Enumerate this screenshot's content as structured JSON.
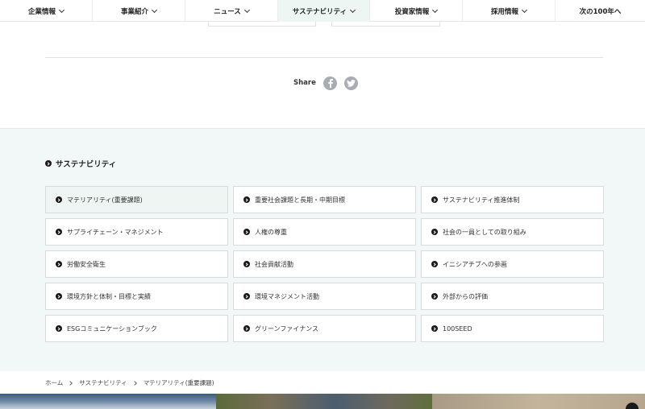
{
  "nav": {
    "items": [
      {
        "label": "企業情報",
        "dropdown": true
      },
      {
        "label": "事業紹介",
        "dropdown": true
      },
      {
        "label": "ニュース",
        "dropdown": true
      },
      {
        "label": "サステナビリティ",
        "dropdown": true,
        "active": true
      },
      {
        "label": "投資家情報",
        "dropdown": true
      },
      {
        "label": "採用情報",
        "dropdown": true
      },
      {
        "label": "次の100年へ",
        "dropdown": false
      }
    ]
  },
  "share": {
    "label": "Share",
    "icons": [
      "facebook-icon",
      "twitter-icon"
    ]
  },
  "sustainability": {
    "title": "サステナビリティ",
    "links": [
      "マテリアリティ(重要課題)",
      "重要社会課題と長期・中期目標",
      "サステナビリティ推進体制",
      "サプライチェーン・マネジメント",
      "人権の尊重",
      "社会の一員としての取り組み",
      "労働安全衛生",
      "社会貢献活動",
      "イニシアチブへの参画",
      "環境方針と体制・目標と実績",
      "環境マネジメント活動",
      "外部からの評価",
      "ESGコミュニケーションブック",
      "グリーンファイナンス",
      "100SEED"
    ],
    "selected_index": 0
  },
  "breadcrumb": [
    "ホーム",
    "サステナビリティ",
    "マテリアリティ(重要課題)"
  ],
  "colors": {
    "panel_bg": "#f1f8f7",
    "active_nav_bg": "#eef6f4",
    "share_icon": "#a9adb1"
  }
}
